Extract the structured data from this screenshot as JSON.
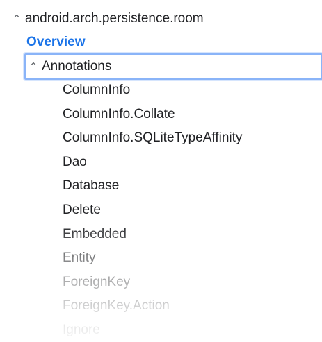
{
  "tree": {
    "root": {
      "label": "android.arch.persistence.room",
      "chevron": "^"
    },
    "overview": {
      "label": "Overview"
    },
    "annotations": {
      "label": "Annotations",
      "chevron": "^",
      "children": [
        "ColumnInfo",
        "ColumnInfo.Collate",
        "ColumnInfo.SQLiteTypeAffinity",
        "Dao",
        "Database",
        "Delete",
        "Embedded",
        "Entity",
        "ForeignKey",
        "ForeignKey.Action",
        "Ignore"
      ]
    }
  },
  "colors": {
    "link": "#1a73e8",
    "focus_border": "#8ab4f8",
    "text": "#202124"
  }
}
